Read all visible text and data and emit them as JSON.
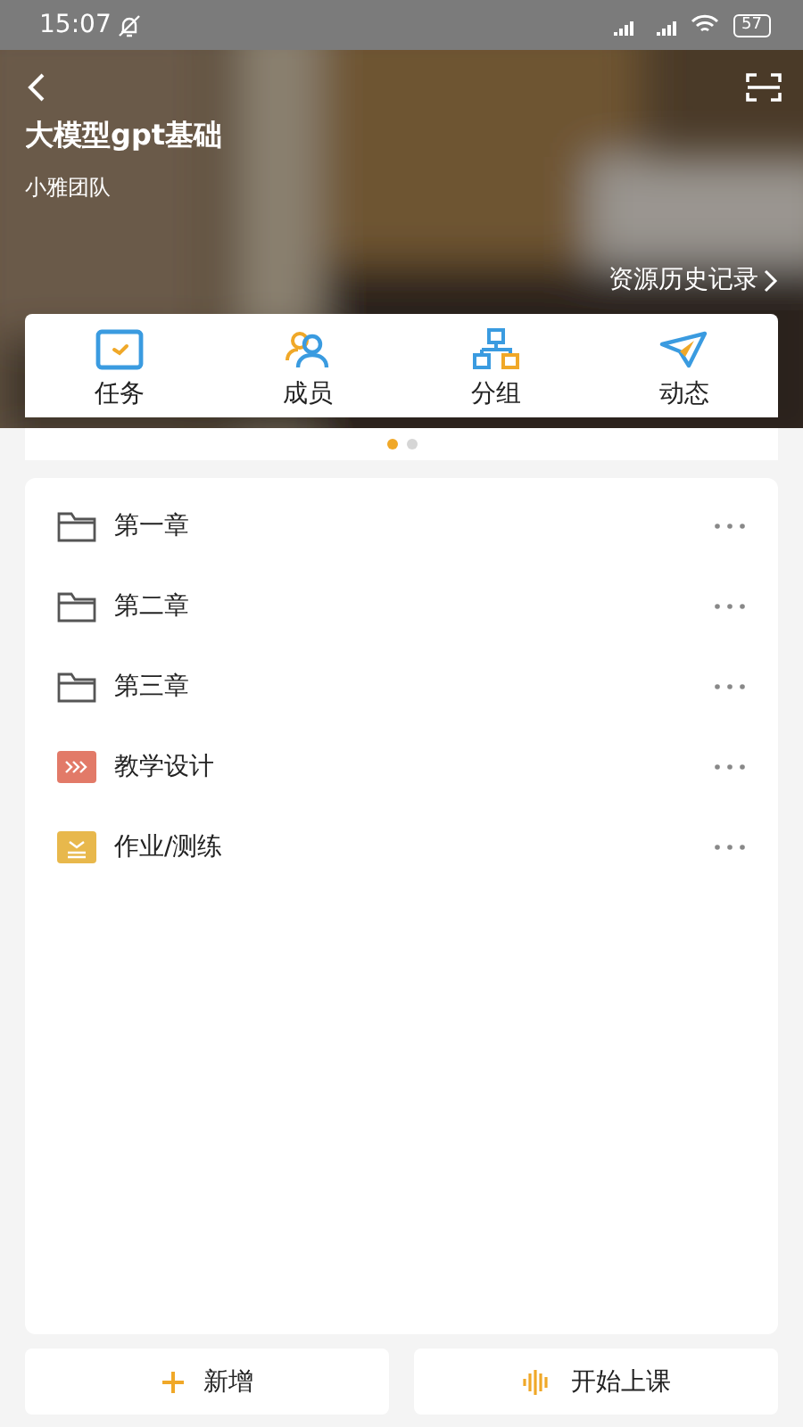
{
  "status_bar": {
    "time": "15:07",
    "battery": "57"
  },
  "header": {
    "title": "大模型gpt基础",
    "team": "小雅团队",
    "history_link": "资源历史记录"
  },
  "features": [
    {
      "kind": "task",
      "label": "任务"
    },
    {
      "kind": "members",
      "label": "成员"
    },
    {
      "kind": "groups",
      "label": "分组"
    },
    {
      "kind": "activity",
      "label": "动态"
    }
  ],
  "pager": [
    {
      "selected": true
    },
    {
      "selected": false
    }
  ],
  "items": [
    {
      "kind": "folder",
      "label": "第一章"
    },
    {
      "kind": "folder",
      "label": "第二章"
    },
    {
      "kind": "folder",
      "label": "第三章"
    },
    {
      "kind": "design",
      "label": "教学设计"
    },
    {
      "kind": "homework",
      "label": "作业/测练"
    }
  ],
  "buttons": [
    {
      "kind": "add",
      "label": "新增"
    },
    {
      "kind": "start",
      "label": "开始上课"
    }
  ]
}
